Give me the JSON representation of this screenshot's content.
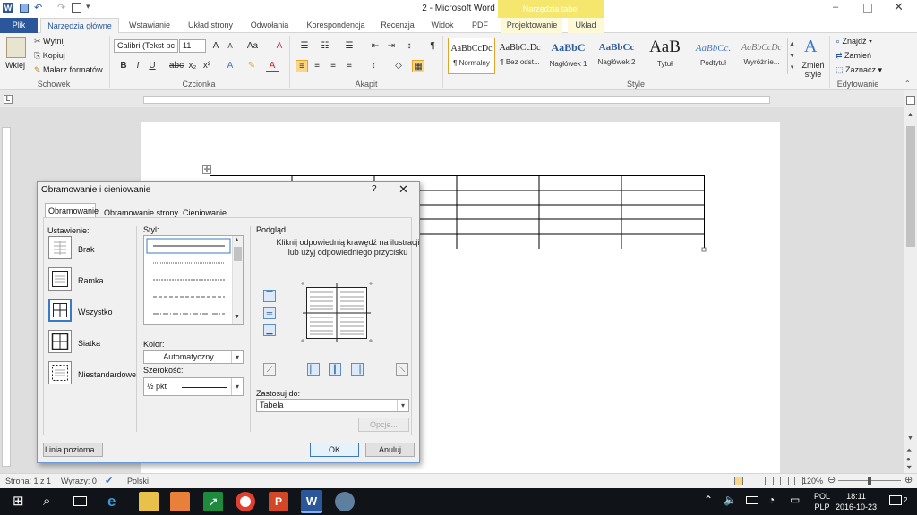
{
  "titlebar": {
    "title": "2 - Microsoft Word",
    "contextual": "Narzędzia tabel"
  },
  "tabs": {
    "file": "Plik",
    "home": "Narzędzia główne",
    "insert": "Wstawianie",
    "layout": "Układ strony",
    "refs": "Odwołania",
    "mail": "Korespondencja",
    "review": "Recenzja",
    "view": "Widok",
    "pdf": "PDF",
    "design": "Projektowanie",
    "table_layout": "Układ"
  },
  "ribbon": {
    "clipboard": {
      "paste": "Wklej",
      "cut": "Wytnij",
      "copy": "Kopiuj",
      "painter": "Malarz formatów",
      "label": "Schowek"
    },
    "font": {
      "name": "Calibri (Tekst pc",
      "size": "11",
      "label": "Czcionka"
    },
    "paragraph": {
      "label": "Akapit"
    },
    "styles": {
      "label": "Style",
      "items": [
        {
          "preview": "AaBbCcDc",
          "name": "¶ Normalny"
        },
        {
          "preview": "AaBbCcDc",
          "name": "¶ Bez odst..."
        },
        {
          "preview": "AaBbC",
          "name": "Nagłówek 1"
        },
        {
          "preview": "AaBbCc",
          "name": "Nagłówek 2"
        },
        {
          "preview": "AaB",
          "name": "Tytuł"
        },
        {
          "preview": "AaBbCc.",
          "name": "Podtytuł"
        },
        {
          "preview": "AaBbCcDc",
          "name": "Wyróżnie..."
        }
      ],
      "change": "Zmień style"
    },
    "editing": {
      "find": "Znajdź",
      "replace": "Zamień",
      "select": "Zaznacz",
      "label": "Edytowanie"
    }
  },
  "dialog": {
    "title": "Obramowanie i cieniowanie",
    "help": "?",
    "tabs": {
      "borders": "Obramowanie",
      "page_borders": "Obramowanie strony",
      "shading": "Cieniowanie"
    },
    "setting": {
      "label": "Ustawienie:",
      "none": "Brak",
      "box": "Ramka",
      "all": "Wszystko",
      "grid": "Siatka",
      "custom": "Niestandardowe"
    },
    "style_label": "Styl:",
    "color": {
      "label": "Kolor:",
      "value": "Automatyczny"
    },
    "width": {
      "label": "Szerokość:",
      "value": "½ pkt"
    },
    "preview": {
      "label": "Podgląd",
      "hint": "Kliknij odpowiednią krawędź na ilustracji lub użyj odpowiedniego przycisku"
    },
    "apply": {
      "label": "Zastosuj do:",
      "value": "Tabela"
    },
    "options": "Opcje...",
    "horizontal_line": "Linia pozioma...",
    "ok": "OK",
    "cancel": "Anuluj"
  },
  "statusbar": {
    "page": "Strona: 1 z 1",
    "words": "Wyrazy: 0",
    "lang": "Polski",
    "zoom": "120%"
  },
  "taskbar": {
    "lang1": "POL",
    "lang2": "PLP",
    "time": "18:11",
    "date": "2016-10-23",
    "notif": "2"
  }
}
